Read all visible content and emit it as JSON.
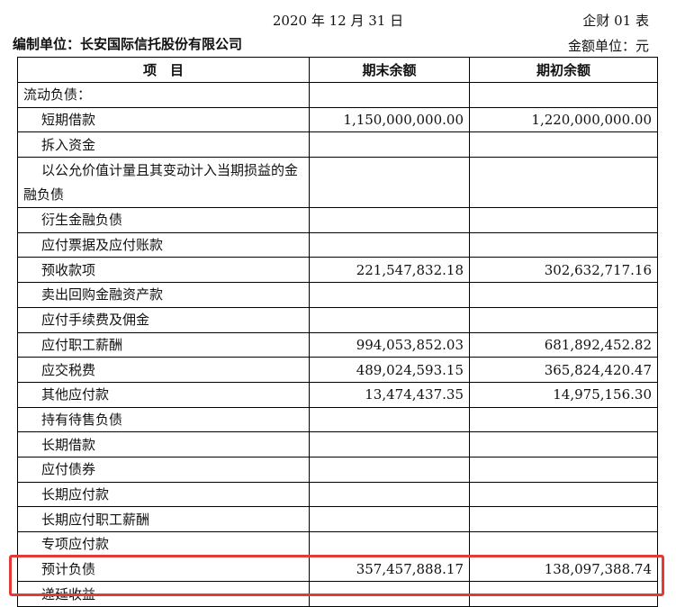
{
  "header": {
    "date": "2020 年 12 月 31 日",
    "form_no": "企财 01 表",
    "company": "编制单位：长安国际信托股份有限公司",
    "unit": "金额单位：元"
  },
  "table": {
    "columns": [
      "项　目",
      "期末余额",
      "期初余额"
    ],
    "rows": [
      {
        "item": "流动负债：",
        "end": "",
        "begin": ""
      },
      {
        "item": "短期借款",
        "end": "1,150,000,000.00",
        "begin": "1,220,000,000.00"
      },
      {
        "item": "拆入资金",
        "end": "",
        "begin": ""
      },
      {
        "item": "以公允价值计量且其变动计入当期损益的金融负债",
        "end": "",
        "begin": ""
      },
      {
        "item": "衍生金融负债",
        "end": "",
        "begin": ""
      },
      {
        "item": "应付票据及应付账款",
        "end": "",
        "begin": ""
      },
      {
        "item": "预收款项",
        "end": "221,547,832.18",
        "begin": "302,632,717.16"
      },
      {
        "item": "卖出回购金融资产款",
        "end": "",
        "begin": ""
      },
      {
        "item": "应付手续费及佣金",
        "end": "",
        "begin": ""
      },
      {
        "item": "应付职工薪酬",
        "end": "994,053,852.03",
        "begin": "681,892,452.82"
      },
      {
        "item": "应交税费",
        "end": "489,024,593.15",
        "begin": "365,824,420.47"
      },
      {
        "item": "其他应付款",
        "end": "13,474,437.35",
        "begin": "14,975,156.30"
      },
      {
        "item": "持有待售负债",
        "end": "",
        "begin": ""
      },
      {
        "item": "长期借款",
        "end": "",
        "begin": ""
      },
      {
        "item": "应付债券",
        "end": "",
        "begin": ""
      },
      {
        "item": "长期应付款",
        "end": "",
        "begin": ""
      },
      {
        "item": "长期应付职工薪酬",
        "end": "",
        "begin": ""
      },
      {
        "item": "专项应付款",
        "end": "",
        "begin": ""
      },
      {
        "item": "预计负债",
        "end": "357,457,888.17",
        "begin": "138,097,388.74"
      },
      {
        "item": "递延收益",
        "end": "",
        "begin": ""
      }
    ]
  },
  "highlight": {
    "color": "#e53935"
  }
}
